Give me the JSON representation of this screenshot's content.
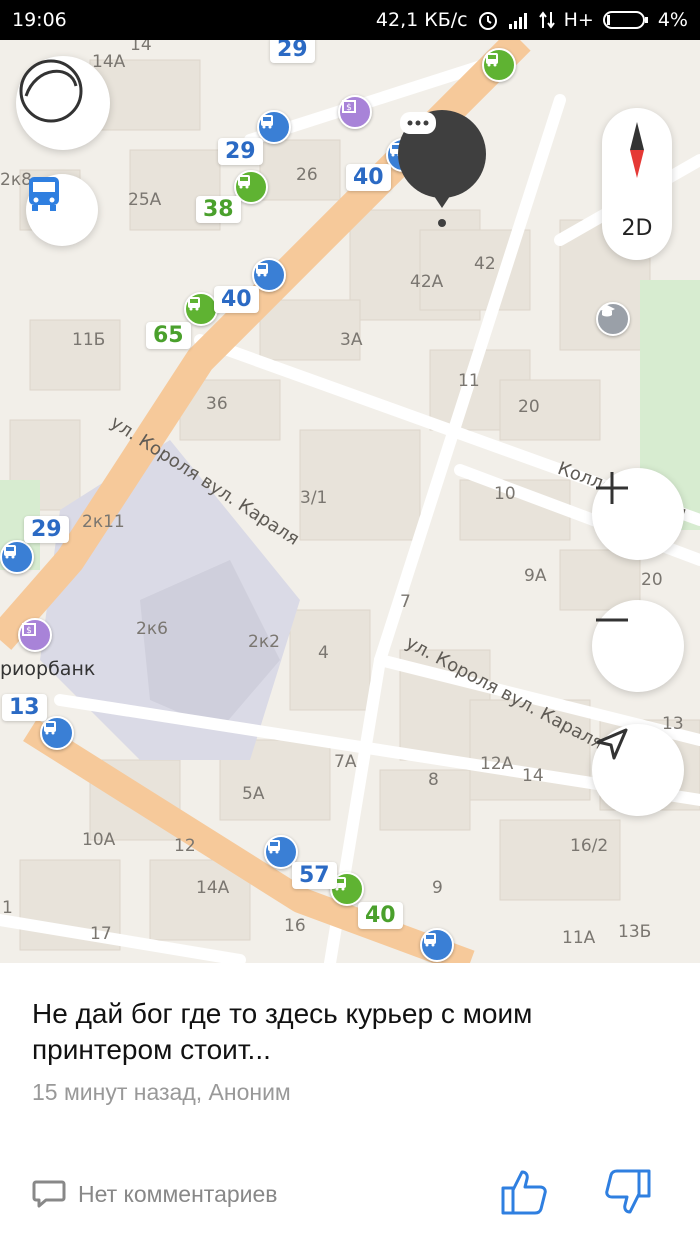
{
  "status_bar": {
    "time": "19:06",
    "network_speed": "42,1 КБ/с",
    "network_type": "H+",
    "battery": "4%"
  },
  "map": {
    "view_mode": "2D",
    "streets": [
      {
        "text": "ул. Короля вул. Караля"
      },
      {
        "text": "ул. Короля вул. Караля"
      },
      {
        "text": "Коллекторная"
      }
    ],
    "poi": {
      "bank_name": "риорбанк"
    },
    "house_numbers": [
      "14",
      "14А",
      "2к8",
      "25А",
      "26",
      "42",
      "42А",
      "11Б",
      "3А",
      "11",
      "36",
      "20",
      "10",
      "3/1",
      "2к11",
      "9А",
      "20",
      "2к6",
      "2к2",
      "7",
      "4",
      "11",
      "13",
      "7А",
      "12А",
      "14",
      "8",
      "5А",
      "10А",
      "12",
      "16/2",
      "14А",
      "9",
      "17",
      "16",
      "11А",
      "13Б",
      "1"
    ],
    "routes": [
      {
        "num": "29",
        "color": "blue"
      },
      {
        "num": "29",
        "color": "blue"
      },
      {
        "num": "40",
        "color": "blue"
      },
      {
        "num": "38",
        "color": "green"
      },
      {
        "num": "40",
        "color": "blue"
      },
      {
        "num": "65",
        "color": "green"
      },
      {
        "num": "29",
        "color": "blue"
      },
      {
        "num": "13",
        "color": "blue"
      },
      {
        "num": "57",
        "color": "blue"
      },
      {
        "num": "40",
        "color": "green"
      }
    ]
  },
  "post": {
    "text": "Не дай бог где то здесь курьер с моим принтером стоит...",
    "meta": "15 минут назад, Аноним",
    "comments_label": "Нет комментариев"
  },
  "colors": {
    "accent_blue": "#2b6ac4",
    "transit_green": "#4aa02c",
    "road_orange": "#f6c99a"
  }
}
